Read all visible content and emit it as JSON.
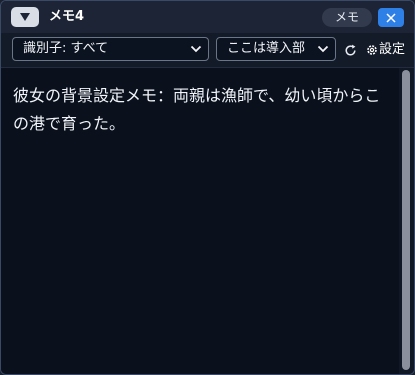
{
  "window": {
    "title": "メモ4",
    "memo_button_label": "メモ"
  },
  "toolbar": {
    "identifier_select_value": "識別子: すべて",
    "intro_select_value": "ここは導入部",
    "settings_label": "設定"
  },
  "memo": {
    "text": "彼女の背景設定メモ：両親は漁師で、幼い頃からこの港で育った。"
  },
  "colors": {
    "accent": "#2e7fe6",
    "window_bg": "#0c1320",
    "text": "#f0f3f7"
  },
  "icons": {
    "collapse": "triangle-down-icon",
    "close": "close-icon",
    "refresh": "refresh-icon",
    "settings": "gear-icon",
    "select": "chevron-down-icon"
  }
}
